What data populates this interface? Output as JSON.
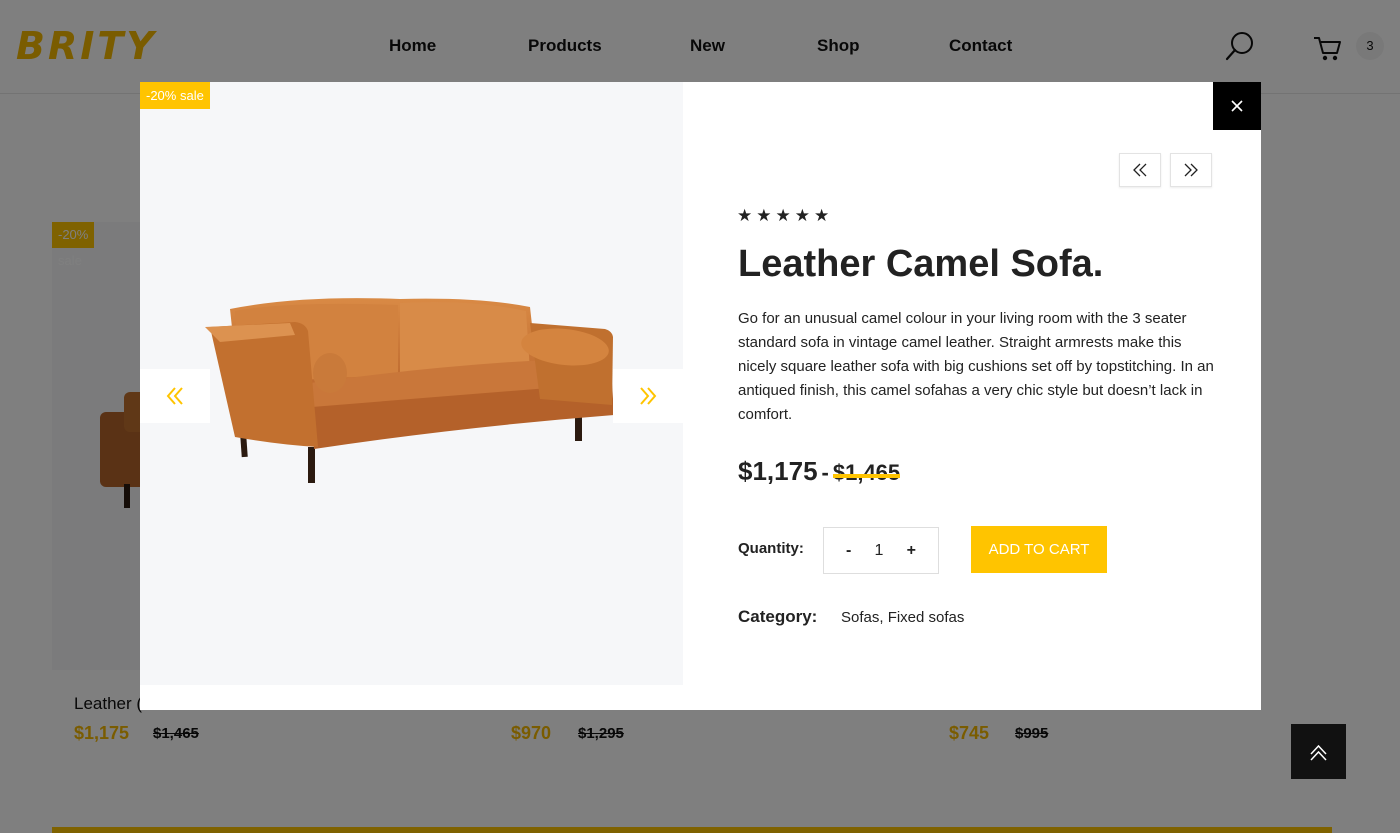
{
  "header": {
    "logo": "BRITY",
    "nav": [
      "Home",
      "Products",
      "New",
      "Shop",
      "Contact"
    ],
    "cart_count": "3"
  },
  "background_products": [
    {
      "sale": "-20% sale",
      "name": "Leather (",
      "price": "$1,175",
      "old_price": "$1,465"
    },
    {
      "price": "$970",
      "old_price": "$1,295"
    },
    {
      "price": "$745",
      "old_price": "$995"
    }
  ],
  "modal": {
    "sale_badge": "-20% sale",
    "rating": 5,
    "title": "Leather Camel Sofa.",
    "description": "Go for an unusual camel colour in your living room with the 3 seater standard sofa in vintage camel leather. Straight armrests make this nicely square leather sofa with big cushions set off by topstitching. In an antiqued finish, this camel sofahas a very chic style but doesn’t lack in comfort.",
    "price": "$1,175",
    "price_separator": "-",
    "old_price": "$1,465",
    "quantity_label": "Quantity:",
    "quantity_minus": "-",
    "quantity_value": "1",
    "quantity_plus": "+",
    "add_to_cart": "ADD TO CART",
    "category_label": "Category:",
    "category_value": "Sofas, Fixed sofas"
  },
  "colors": {
    "accent": "#ffc400",
    "dark": "#000000"
  }
}
